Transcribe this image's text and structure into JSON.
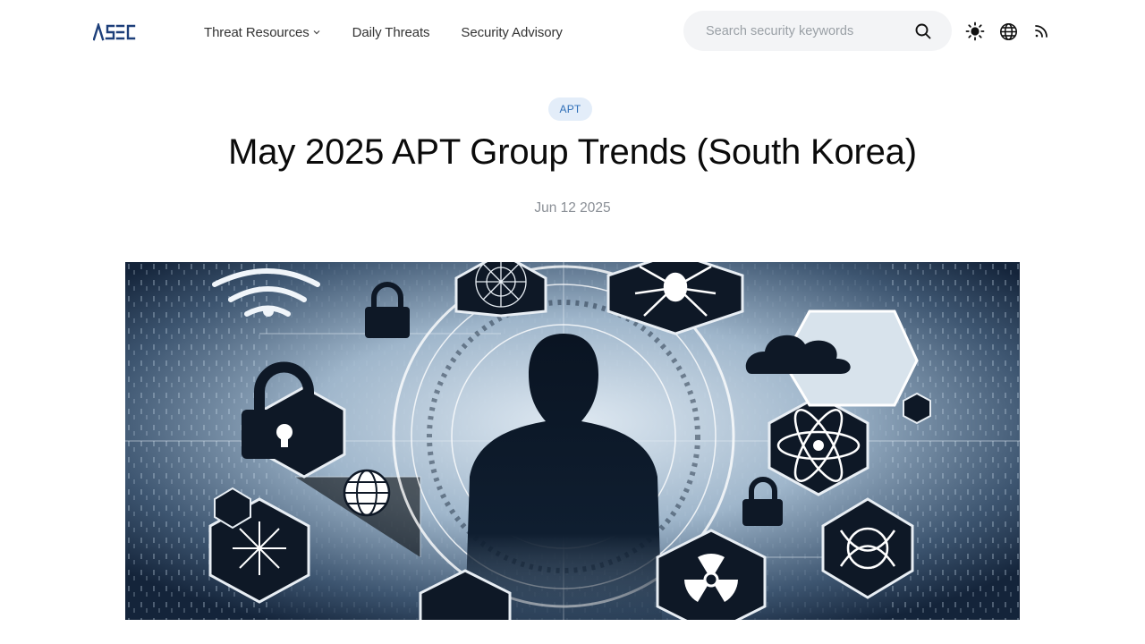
{
  "header": {
    "logo_text": "ASEC",
    "nav": [
      {
        "label": "Threat Resources",
        "has_dropdown": true
      },
      {
        "label": "Daily Threats",
        "has_dropdown": false
      },
      {
        "label": "Security Advisory",
        "has_dropdown": false
      }
    ],
    "search": {
      "placeholder": "Search security keywords",
      "value": ""
    },
    "icons": [
      "theme-toggle-icon",
      "globe-icon",
      "rss-icon"
    ]
  },
  "article": {
    "category": "APT",
    "title": "May 2025 APT Group Trends (South Korea)",
    "date": "Jun 12 2025",
    "hero_image": "cyber-silhouette-hexagon-icons"
  },
  "colors": {
    "badge_bg": "#e3edf9",
    "badge_text": "#2f6fb8",
    "search_bg": "#f3f4f6",
    "logo": "#1d3f7a"
  }
}
